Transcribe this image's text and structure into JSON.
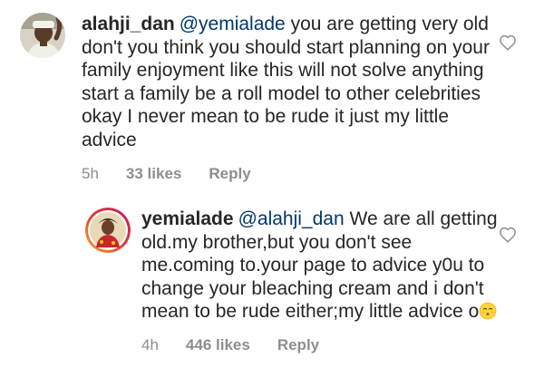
{
  "comments": [
    {
      "username": "alahji_dan",
      "mention": "@yemialade",
      "text": "you are getting very old don't you think you should start planning on your family enjoyment like this will not solve anything start a family be a roll model to other celebrities okay I never mean to be rude it just my little advice",
      "time": "5h",
      "likes": "33 likes",
      "reply_label": "Reply",
      "avatar_icon": "user-avatar-alahji",
      "heart_icon": "heart-outline-icon"
    },
    {
      "username": "yemialade",
      "mention": "@alahji_dan",
      "text": "We are all getting old.my brother,but you don't see me.coming to.your page to advice y0u to change your bleaching cream and i don't mean to be rude either;my little advice o",
      "emoji": "kissing-face-emoji",
      "time": "4h",
      "likes": "446 likes",
      "reply_label": "Reply",
      "avatar_icon": "user-avatar-yemialade",
      "heart_icon": "heart-outline-icon"
    }
  ],
  "colors": {
    "text": "#262626",
    "mention": "#00376b",
    "meta": "#8e8e8e",
    "story_ring_start": "#f9a825",
    "story_ring_end": "#c2185b"
  }
}
